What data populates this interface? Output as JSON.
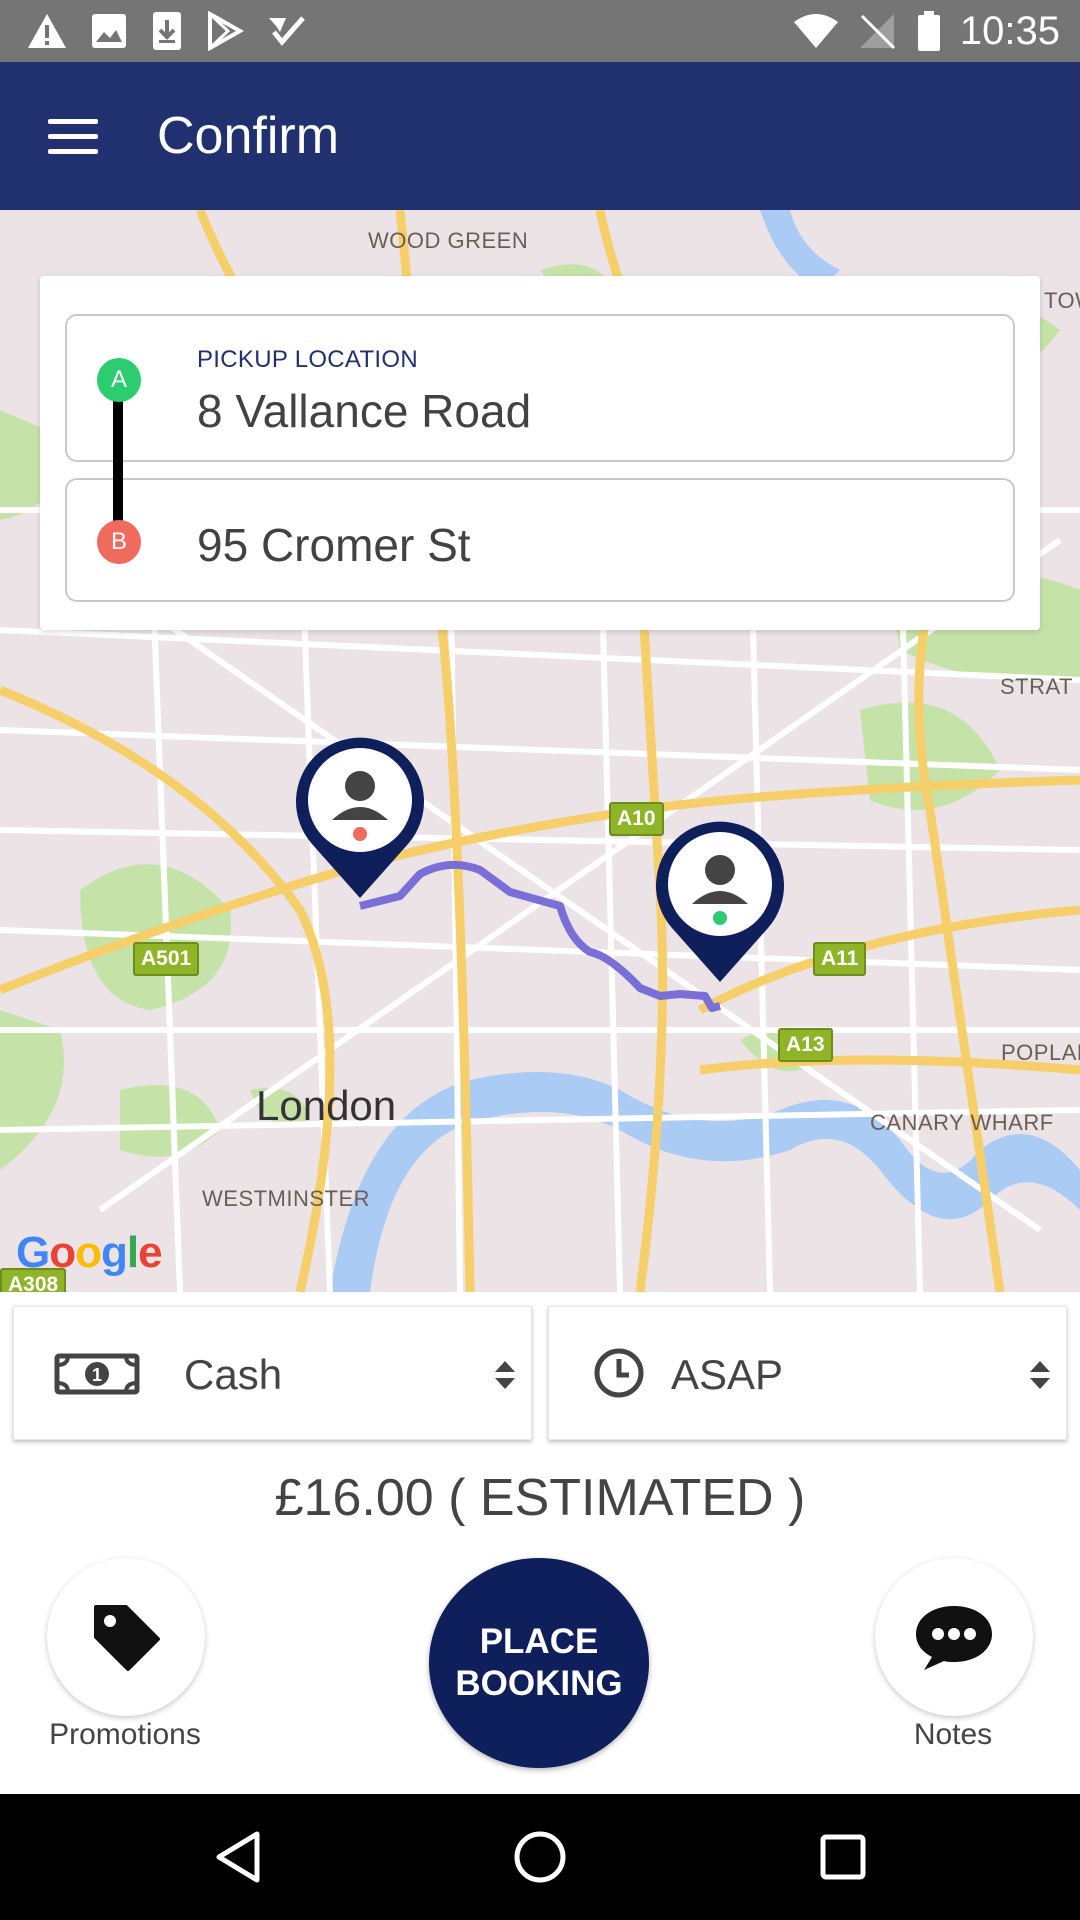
{
  "status_bar": {
    "time": "10:35",
    "left_icons": [
      "warning-icon",
      "image-icon",
      "download-icon",
      "play-store-icon",
      "check-icon"
    ],
    "right_icons": [
      "wifi-icon",
      "no-signal-icon",
      "battery-icon"
    ]
  },
  "app_bar": {
    "title": "Confirm",
    "menu_icon": "hamburger-menu-icon",
    "color": "#213170"
  },
  "route": {
    "pickup_caption": "PICKUP LOCATION",
    "pickup_address": "8 Vallance Road",
    "dropoff_address": "95 Cromer St",
    "marker_a": "A",
    "marker_b": "B",
    "marker_a_color": "#2ecc71",
    "marker_b_color": "#ee6b5e"
  },
  "map": {
    "labels": {
      "wood_green": "WOOD GREEN",
      "tow": "TOW",
      "strat": "STRAT",
      "london": "London",
      "westminster": "WESTMINSTER",
      "canary_wharf": "CANARY WHARF",
      "poplar": "POPLAR"
    },
    "shields": {
      "a10": "A10",
      "a11": "A11",
      "a13": "A13",
      "a501": "A501",
      "a308": "A308"
    },
    "attribution": [
      "G",
      "o",
      "o",
      "g",
      "l",
      "e"
    ],
    "route_color": "#7a6fd6"
  },
  "options": {
    "payment": "Cash",
    "payment_icon": "cash-icon",
    "time": "ASAP",
    "time_icon": "clock-icon",
    "dropdown_icon": "sort-arrows-icon"
  },
  "price": "£16.00 ( ESTIMATED )",
  "actions": {
    "promotions_label": "Promotions",
    "promotions_icon": "tag-icon",
    "place_booking_label": "PLACE BOOKING",
    "notes_label": "Notes",
    "notes_icon": "chat-bubble-icon",
    "primary_color": "#0e1f5b"
  },
  "nav_bar": {
    "icons": [
      "back-icon",
      "home-icon",
      "recents-icon"
    ]
  }
}
